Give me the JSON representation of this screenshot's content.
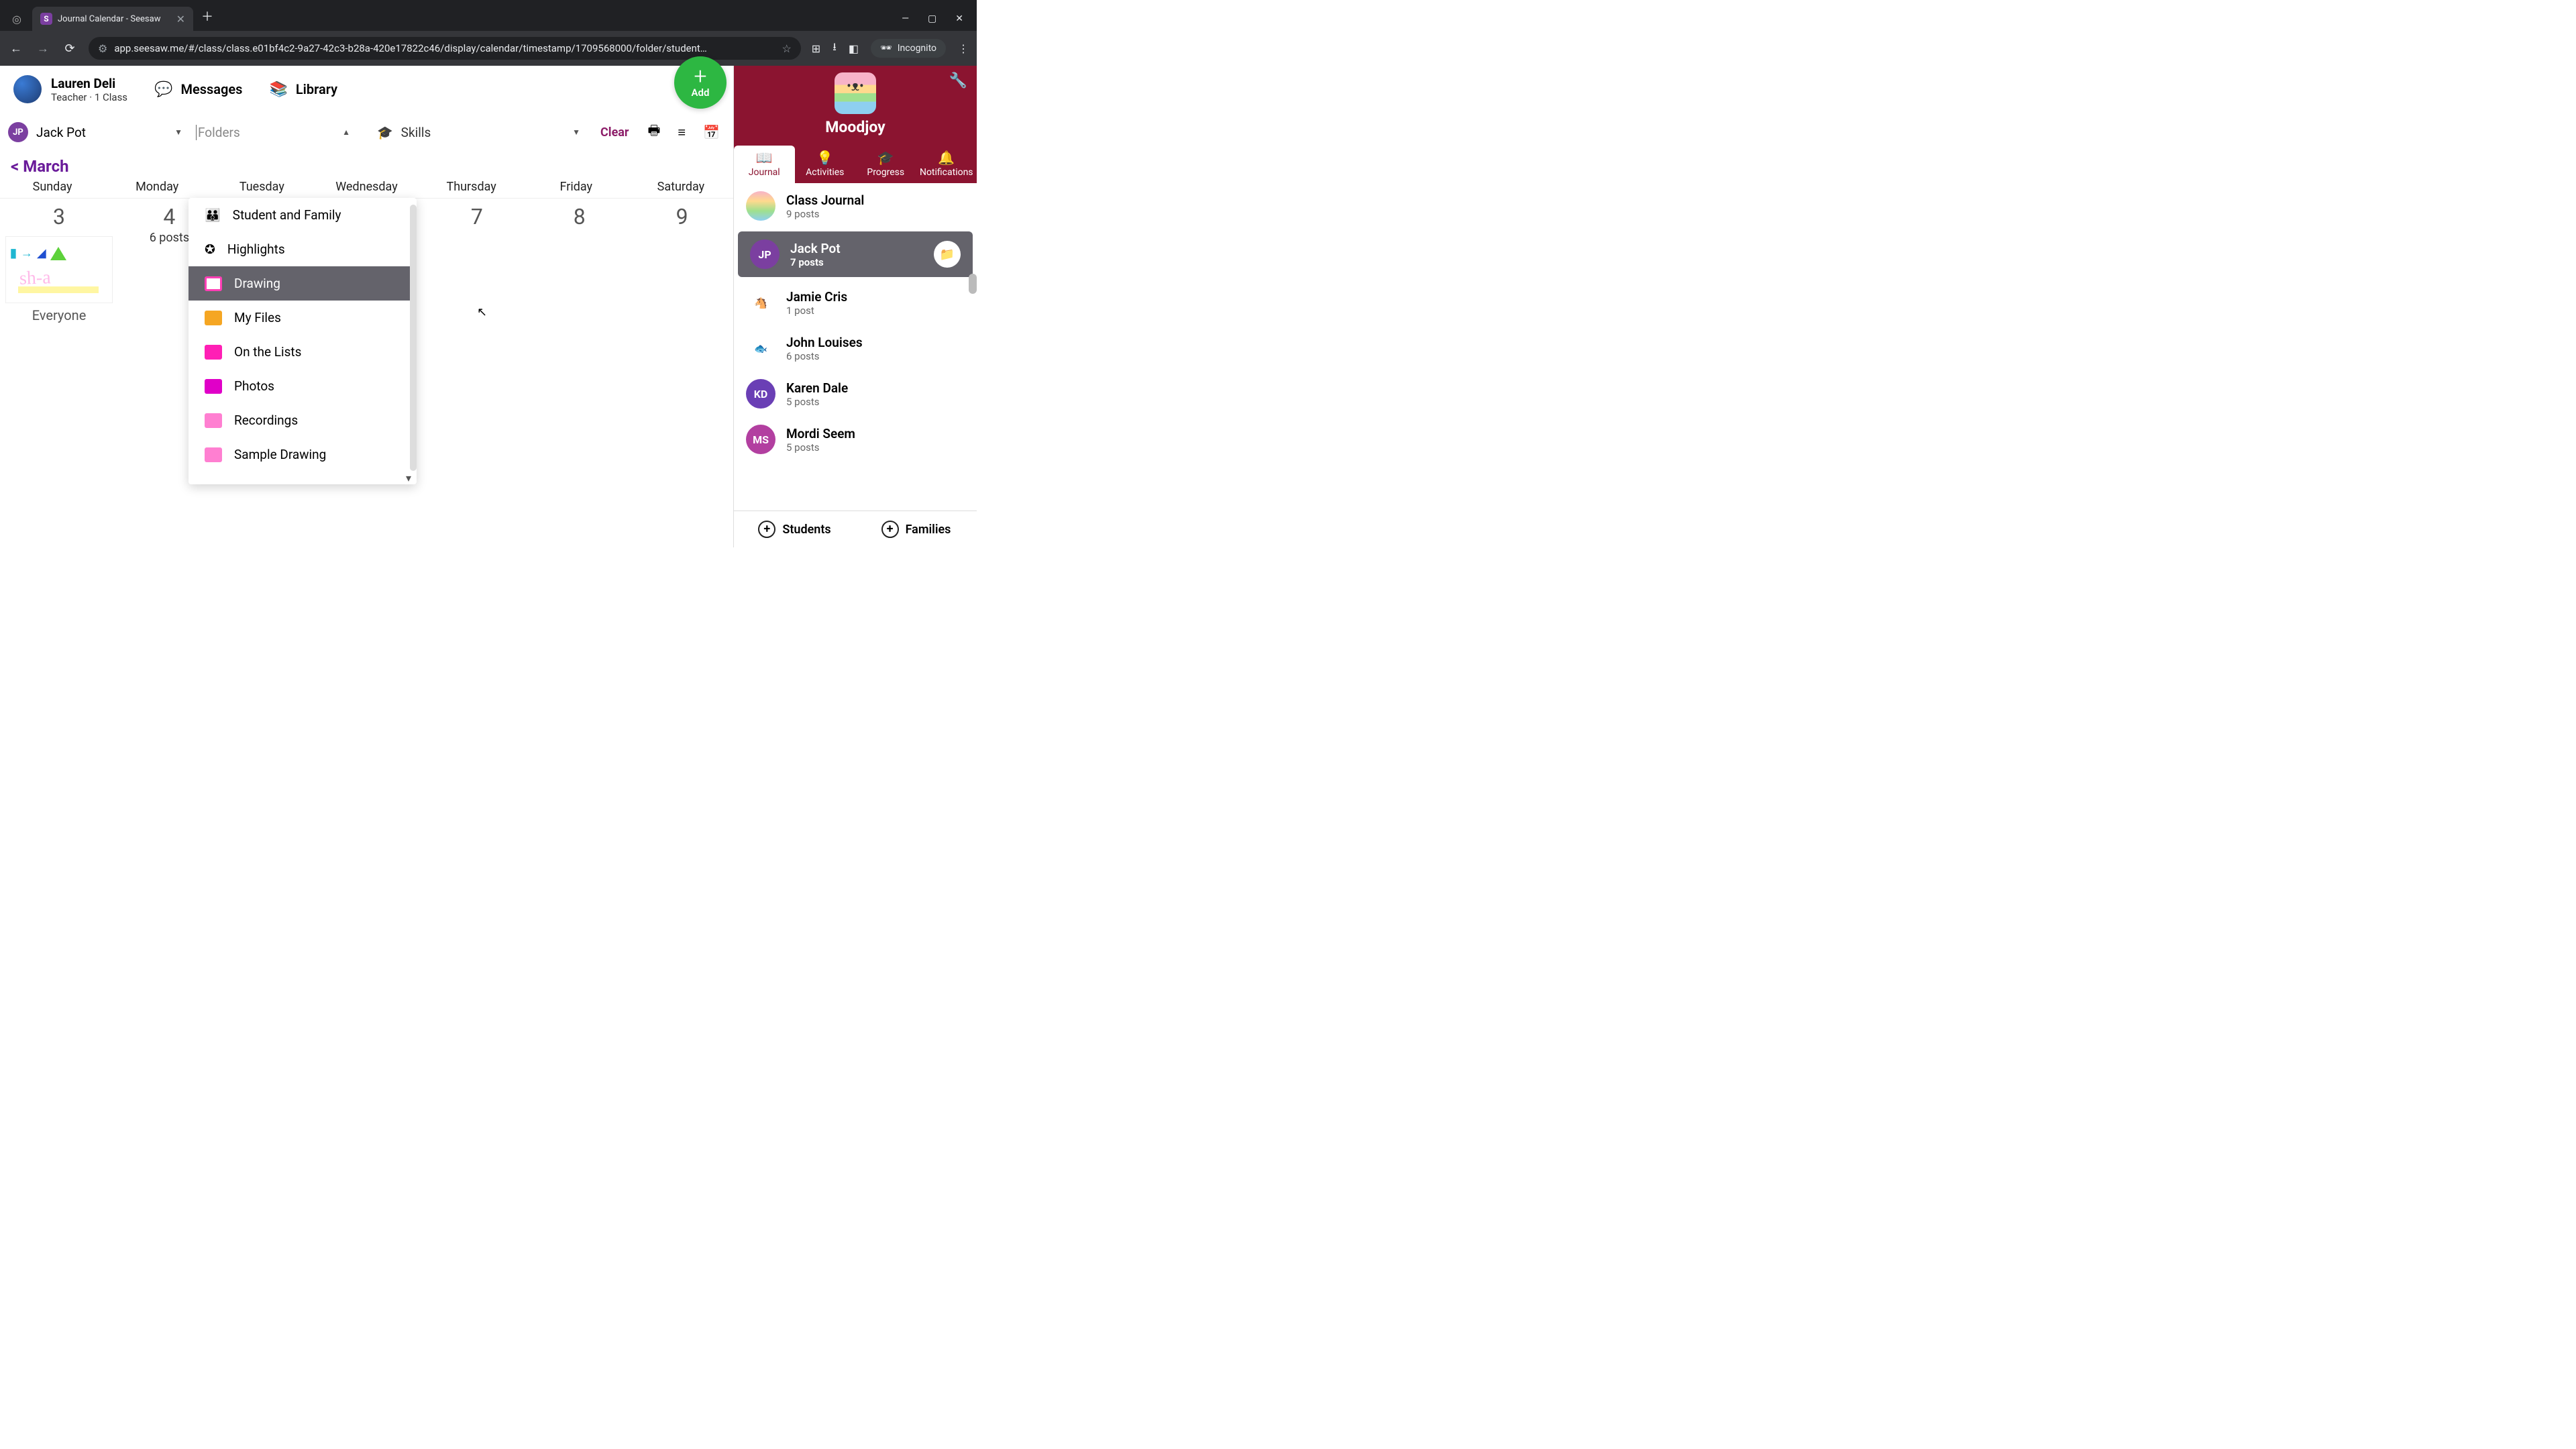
{
  "browser": {
    "tab_title": "Journal Calendar - Seesaw",
    "url": "app.seesaw.me/#/class/class.e01bf4c2-9a27-42c3-b28a-420e17822c46/display/calendar/timestamp/1709568000/folder/student…",
    "incognito_label": "Incognito"
  },
  "user": {
    "name": "Lauren Deli",
    "role": "Teacher · 1 Class"
  },
  "topnav": {
    "messages": "Messages",
    "library": "Library"
  },
  "filters": {
    "student_initials": "JP",
    "student_name": "Jack Pot",
    "folders_label": "Folders",
    "skills_label": "Skills",
    "clear_label": "Clear"
  },
  "add_button": {
    "label": "Add"
  },
  "month": {
    "label": "< March"
  },
  "days": [
    "Sunday",
    "Monday",
    "Tuesday",
    "Wednesday",
    "Thursday",
    "Friday",
    "Saturday"
  ],
  "dates": {
    "sun": "3",
    "mon": "4",
    "mon_sub": "6 posts",
    "thu": "7",
    "fri": "8",
    "sat": "9"
  },
  "post_card": {
    "caption": "Everyone",
    "scribble": "sh-a"
  },
  "folders": {
    "student_family": "Student and Family",
    "highlights": "Highlights",
    "drawing": "Drawing",
    "my_files": "My Files",
    "on_the_lists": "On the Lists",
    "photos": "Photos",
    "recordings": "Recordings",
    "sample_drawing": "Sample Drawing"
  },
  "class": {
    "name": "Moodjoy",
    "tabs": {
      "journal": "Journal",
      "activities": "Activities",
      "progress": "Progress",
      "notifications": "Notifications"
    }
  },
  "students": [
    {
      "name": "Class Journal",
      "posts": "9 posts",
      "avatar_bg": "linear-gradient(180deg,#f7b3c8,#ffd98e,#9fe08e,#8ecff0)",
      "initials": ""
    },
    {
      "name": "Jack Pot",
      "posts": "7 posts",
      "avatar_bg": "#7b3fa0",
      "initials": "JP",
      "selected": true,
      "badge": true
    },
    {
      "name": "Jamie Cris",
      "posts": "1 post",
      "avatar_bg": "#c49a6c",
      "initials": "🐴"
    },
    {
      "name": "John Louises",
      "posts": "6 posts",
      "avatar_bg": "#bfe9f7",
      "initials": "🐟"
    },
    {
      "name": "Karen Dale",
      "posts": "5 posts",
      "avatar_bg": "#6a3fb5",
      "initials": "KD"
    },
    {
      "name": "Mordi Seem",
      "posts": "5 posts",
      "avatar_bg": "#b23fa0",
      "initials": "MS"
    }
  ],
  "bottom": {
    "students": "Students",
    "families": "Families"
  }
}
